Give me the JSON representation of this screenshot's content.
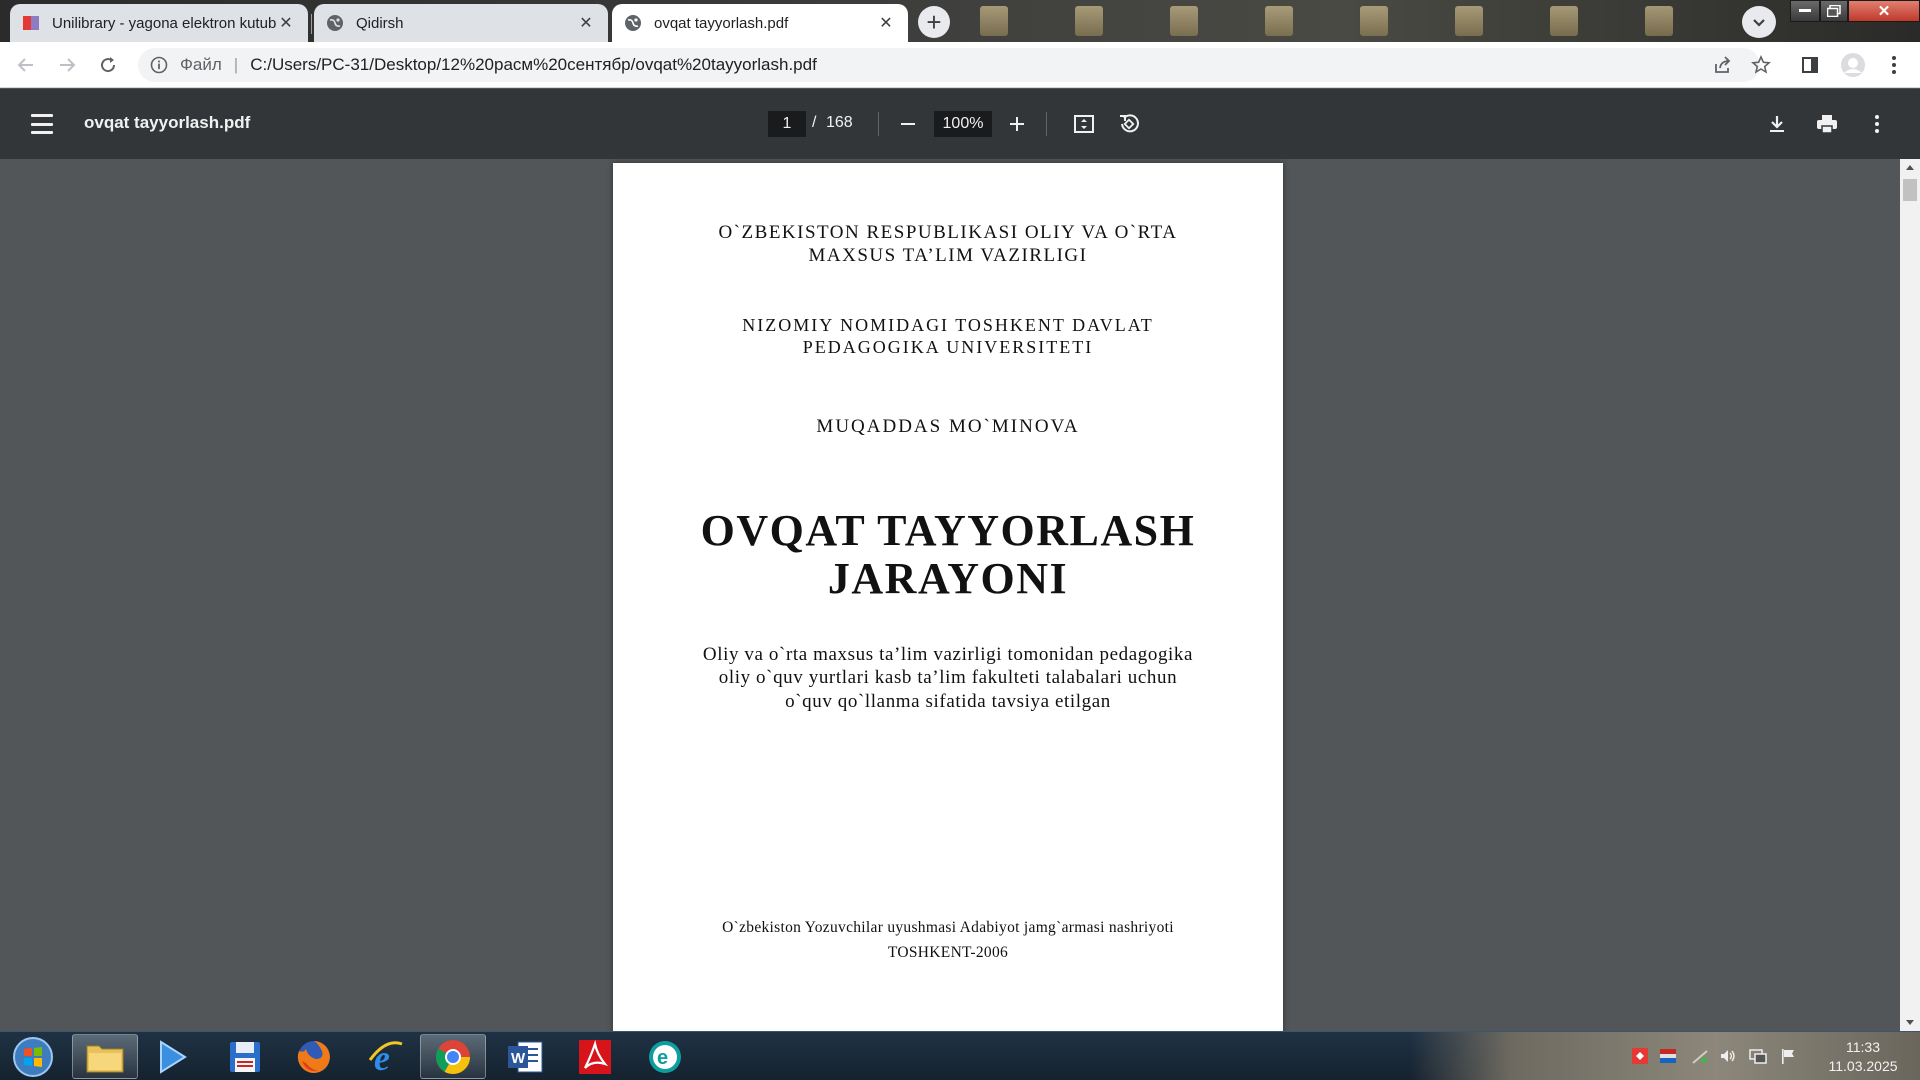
{
  "browser": {
    "tabs": [
      {
        "title": "Unilibrary - yagona elektron kutubxona",
        "favicon": "unilibrary-icon",
        "active": false
      },
      {
        "title": "Qidirsh",
        "favicon": "globe-icon",
        "active": false
      },
      {
        "title": "ovqat tayyorlash.pdf",
        "favicon": "globe-icon",
        "active": true
      }
    ],
    "address": {
      "scheme_label": "Файл",
      "url": "C:/Users/PC-31/Desktop/12%20расм%20сентябр/ovqat%20tayyorlash.pdf"
    }
  },
  "pdf_viewer": {
    "file_name": "ovqat tayyorlash.pdf",
    "current_page": "1",
    "page_separator": "/",
    "total_pages": "168",
    "zoom": "100%"
  },
  "document": {
    "ministry_line1": "O`ZBEKISTON RESPUBLIKASI OLIY VA O`RTA",
    "ministry_line2": "MAXSUS TA’LIM VAZIRLIGI",
    "university_line1": "NIZOMIY NOMIDAGI TOSHKENT DAVLAT",
    "university_line2": "PEDAGOGIKA UNIVERSITETI",
    "author": "MUQADDAS MO`MINOVA",
    "title_line1": "OVQAT TAYYORLASH",
    "title_line2": "JARAYONI",
    "recommendation_line1": "Oliy va o`rta maxsus ta’lim vazirligi tomonidan pedagogika",
    "recommendation_line2": "oliy o`quv yurtlari kasb ta’lim fakulteti talabalari uchun",
    "recommendation_line3": "o`quv qo`llanma sifatida tavsiya etilgan",
    "publisher": "O`zbekiston Yozuvchilar uyushmasi Adabiyot jamg`armasi nashriyoti",
    "place_year": "TOSHKENT-2006"
  },
  "taskbar": {
    "apps": [
      "start-orb-icon",
      "file-explorer-icon",
      "media-player-icon",
      "floppy-save-icon",
      "firefox-icon",
      "internet-explorer-icon",
      "chrome-icon",
      "word-icon",
      "acrobat-icon",
      "eset-icon"
    ],
    "clock_time": "11:33",
    "clock_date": "11.03.2025"
  },
  "colors": {
    "pdf_toolbar": "#323639",
    "viewer_bg": "#525659",
    "taskbar": "#1a2a3a"
  }
}
